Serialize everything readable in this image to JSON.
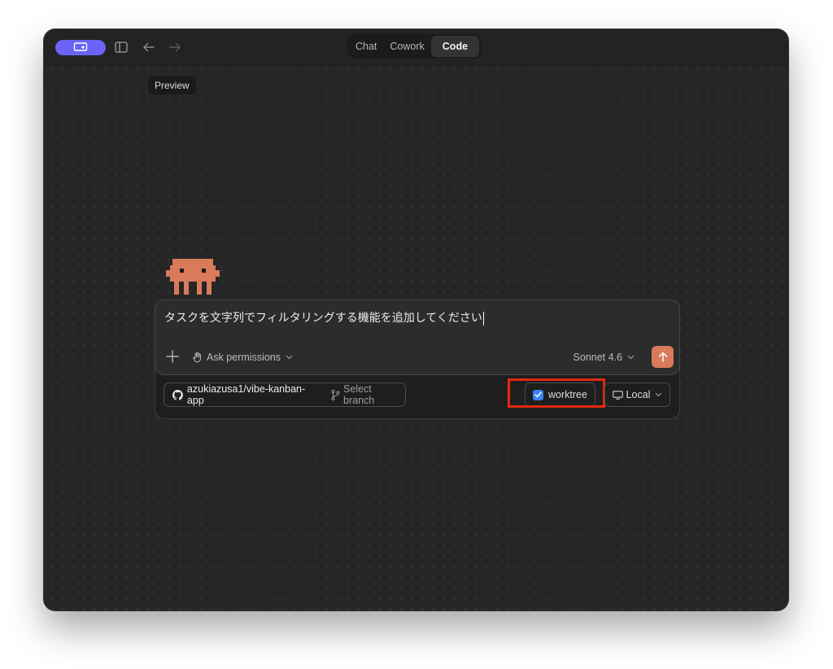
{
  "header": {
    "tabs": [
      {
        "label": "Chat",
        "active": false
      },
      {
        "label": "Cowork",
        "active": false
      },
      {
        "label": "Code",
        "active": true
      }
    ]
  },
  "tooltip": {
    "preview": "Preview"
  },
  "composer": {
    "prompt_value": "タスクを文字列でフィルタリングする機能を追加してください",
    "permissions_label": "Ask permissions",
    "model_label": "Sonnet 4.6"
  },
  "context_bar": {
    "repo_label": "azukiazusa1/vibe-kanban-app",
    "branch_label": "Select branch",
    "worktree_label": "worktree",
    "worktree_checked": true,
    "environment_label": "Local"
  },
  "colors": {
    "accent": "#6b63f5",
    "send_button": "#d97a5a",
    "mascot": "#d97a5a",
    "highlight": "#e3290f",
    "checkbox": "#3b82f6"
  }
}
